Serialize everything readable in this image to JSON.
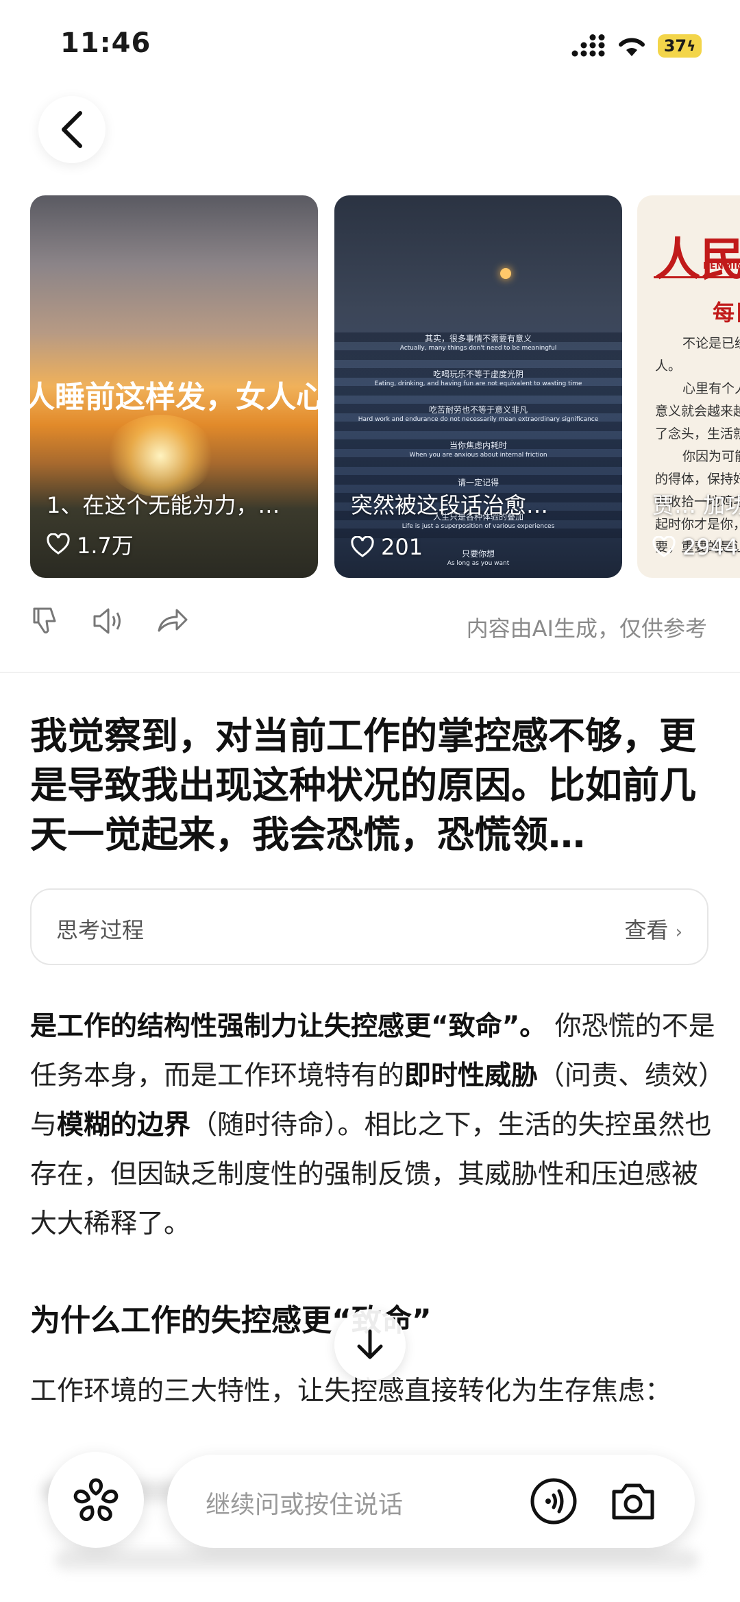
{
  "status": {
    "time": "11:46",
    "battery": "37"
  },
  "cards": [
    {
      "overlay": "人睡前这样发，女人心疼",
      "caption": "1、在这个无能为力，…",
      "likes": "1.7万"
    },
    {
      "caption": "突然被这段话治愈…",
      "likes": "201",
      "lines": [
        "其实，很多事情不需要有意义",
        "Actually, many things don't need to be meaningful",
        "吃喝玩乐不等于虚度光阴",
        "Eating, drinking, and having fun are not equivalent to wasting time",
        "吃苦耐劳也不等于意义非凡",
        "Hard work and endurance do not necessarily mean extraordinary significance",
        "当你焦虑内耗时",
        "When you are anxious about internal friction",
        "请一定记得",
        "人生只是各种体验的叠加",
        "Life is just a superposition of various experiences",
        "只要你想",
        "As long as you want"
      ]
    },
    {
      "overlay": "人民",
      "subtitle": "RENMIN",
      "heading": "每日",
      "caption": "贾… 加功",
      "likes": "2944",
      "lines": [
        "不论是已经",
        "人。",
        "心里有个人",
        "意义就会越来越",
        "了念头，生活就",
        "你因为可能",
        "的得体，保持好",
        "去收拾一地鸡毛",
        "起时你才是你，",
        "要，重要的是让"
      ]
    }
  ],
  "actions": {
    "disclaimer": "内容由AI生成，仅供参考"
  },
  "question": "我觉察到，对当前工作的掌控感不够，更是导致我出现这种状况的原因。比如前几天一觉起来，我会恐慌，恐慌领…",
  "thinking": {
    "label": "思考过程",
    "view": "查看"
  },
  "answer": {
    "b1": "是工作的结构性强制力让失控感更“致命”。",
    "t1": " 你恐慌的不是任务本身，而是工作环境特有的",
    "b2": "即时性威胁",
    "t2": "（问责、绩效）与",
    "b3": "模糊的边界",
    "t3": "（随时待命）。相比之下，生活的失控虽然也存在，但因缺乏制度性的强制反馈，其威胁性和压迫感被大大稀释了。"
  },
  "section": {
    "heading": "为什么工作的失控感更“致命”",
    "para": "工作环境的三大特性，让失控感直接转化为生存焦虑："
  },
  "input": {
    "placeholder": "继续问或按住说话"
  }
}
